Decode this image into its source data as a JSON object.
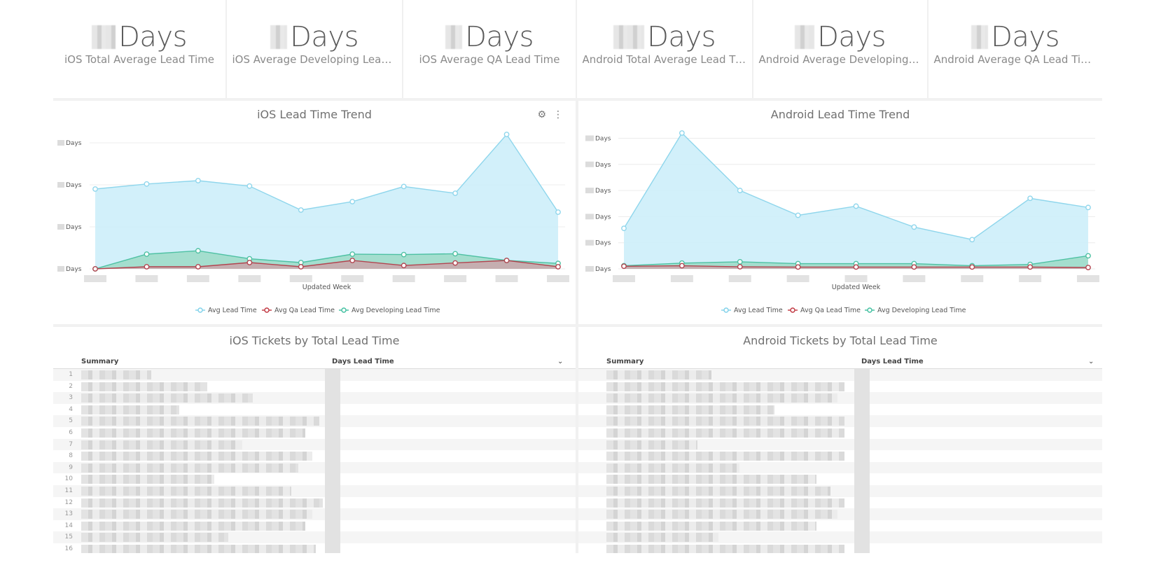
{
  "kpis": [
    {
      "unit": "Days",
      "label": "iOS Total Average Lead Time"
    },
    {
      "unit": "Days",
      "label": "iOS Average Developing Lead Ti..."
    },
    {
      "unit": "Days",
      "label": "iOS Average QA Lead Time"
    },
    {
      "unit": "Days",
      "label": "Android Total Average Lead Time"
    },
    {
      "unit": "Days",
      "label": "Android Average Developing Le..."
    },
    {
      "unit": "Days",
      "label": "Android Average QA Lead Time"
    }
  ],
  "ios_trend": {
    "title": "iOS Lead Time Trend",
    "tools": {
      "alert_icon": "bell-icon",
      "menu_icon": "more-vertical-icon"
    },
    "y_tick_unit": "Days",
    "xlabel": "Updated Week"
  },
  "android_trend": {
    "title": "Android Lead Time Trend",
    "y_tick_unit": "Days",
    "xlabel": "Updated Week"
  },
  "legend": [
    {
      "name": "Avg Lead Time",
      "color": "#7fd1ea"
    },
    {
      "name": "Avg Qa Lead Time",
      "color": "#c0353f"
    },
    {
      "name": "Avg Developing Lead Time",
      "color": "#3fbf9f"
    }
  ],
  "chart_data": [
    {
      "type": "area",
      "title": "iOS Lead Time Trend",
      "xlabel": "Updated Week",
      "ylabel": "",
      "ylim": [
        0,
        3.2
      ],
      "series": [
        {
          "name": "Avg Lead Time",
          "values": [
            1.9,
            2.02,
            2.1,
            1.97,
            1.4,
            1.6,
            1.96,
            1.8,
            3.2,
            1.35
          ]
        },
        {
          "name": "Avg Developing Lead Time",
          "values": [
            0.0,
            0.35,
            0.43,
            0.24,
            0.15,
            0.35,
            0.34,
            0.36,
            0.2,
            0.13
          ]
        },
        {
          "name": "Avg Qa Lead Time",
          "values": [
            0.0,
            0.05,
            0.05,
            0.15,
            0.05,
            0.2,
            0.08,
            0.14,
            0.2,
            0.05
          ]
        }
      ]
    },
    {
      "type": "area",
      "title": "Android Lead Time Trend",
      "xlabel": "Updated Week",
      "ylabel": "",
      "ylim": [
        0,
        5.2
      ],
      "series": [
        {
          "name": "Avg Lead Time",
          "values": [
            1.55,
            5.2,
            3.0,
            2.05,
            2.4,
            1.6,
            1.12,
            2.7,
            2.35
          ]
        },
        {
          "name": "Avg Developing Lead Time",
          "values": [
            0.12,
            0.22,
            0.27,
            0.2,
            0.2,
            0.2,
            0.12,
            0.17,
            0.5
          ]
        },
        {
          "name": "Avg Qa Lead Time",
          "values": [
            0.1,
            0.12,
            0.08,
            0.07,
            0.07,
            0.07,
            0.07,
            0.07,
            0.05
          ]
        }
      ]
    }
  ],
  "ios_table": {
    "title": "iOS Tickets by Total Lead Time",
    "col_summary": "Summary",
    "col_days": "Days Lead Time",
    "row_numbers": [
      "1",
      "2",
      "3",
      "4",
      "5",
      "6",
      "7",
      "8",
      "9",
      "10",
      "11",
      "12",
      "13",
      "14",
      "15",
      "16"
    ]
  },
  "android_table": {
    "title": "Android Tickets by Total Lead Time",
    "col_summary": "Summary",
    "col_days": "Days Lead Time"
  }
}
